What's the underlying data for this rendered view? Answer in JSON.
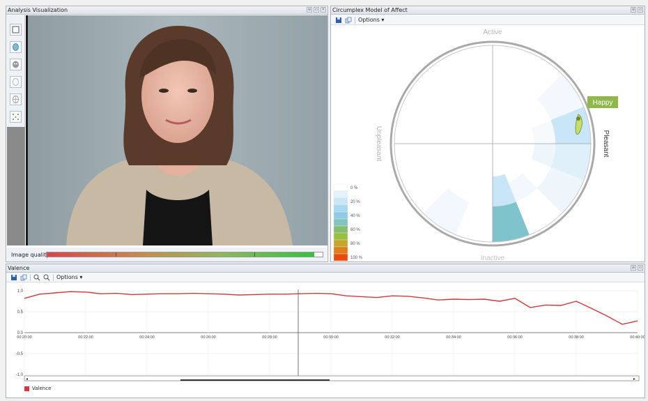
{
  "analysis": {
    "title": "Analysis Visualization",
    "image_quality_label": "Image quality",
    "image_quality_value": 0.97,
    "tools": [
      "select-tool-icon",
      "face-model-icon",
      "face-mask-icon",
      "face-outline-icon",
      "face-grid-icon",
      "points-icon"
    ]
  },
  "circumplex": {
    "title": "Circumplex Model of Affect",
    "options_label": "Options ▾",
    "axis_top": "Active",
    "axis_bottom": "Inactive",
    "axis_left": "Unpleasant",
    "axis_right": "Pleasant",
    "emotion_badge": "Happy",
    "badge_color": "#8fb84a",
    "legend": [
      {
        "label": "0 %",
        "color": "#ffffff"
      },
      {
        "label": "",
        "color": "#e3f2fb"
      },
      {
        "label": "20 %",
        "color": "#c8e6f7"
      },
      {
        "label": "",
        "color": "#a9d8f1"
      },
      {
        "label": "40 %",
        "color": "#8fcbe6"
      },
      {
        "label": "",
        "color": "#7fc4bf"
      },
      {
        "label": "60 %",
        "color": "#86be6c"
      },
      {
        "label": "",
        "color": "#9cbf3e"
      },
      {
        "label": "80 %",
        "color": "#c4a62a"
      },
      {
        "label": "",
        "color": "#e07d16"
      },
      {
        "label": "100 %",
        "color": "#e84b0c"
      }
    ]
  },
  "valence": {
    "title": "Valence",
    "options_label": "Options ▾",
    "legend_label": "Valence",
    "series_color": "#d7363a",
    "y_ticks": [
      "1.0",
      "0.5",
      "0.0",
      "-0.5",
      "-1.0"
    ],
    "x_ticks": [
      "00:20:00",
      "00:22:00",
      "00:24:00",
      "00:26:00",
      "00:28:00",
      "00:30:00",
      "00:32:00",
      "00:34:00",
      "00:36:00",
      "00:38:00",
      "00:40:00"
    ]
  },
  "chart_data": {
    "type": "line",
    "xlabel": "",
    "ylabel": "",
    "ylim": [
      -1,
      1
    ],
    "x": [
      "00:20:00",
      "00:20:30",
      "00:21:00",
      "00:21:30",
      "00:22:00",
      "00:22:30",
      "00:23:00",
      "00:23:30",
      "00:24:00",
      "00:24:30",
      "00:25:00",
      "00:25:30",
      "00:26:00",
      "00:26:30",
      "00:27:00",
      "00:27:30",
      "00:28:00",
      "00:28:30",
      "00:29:00",
      "00:29:30",
      "00:30:00",
      "00:30:30",
      "00:31:00",
      "00:31:30",
      "00:32:00",
      "00:32:30",
      "00:33:00",
      "00:33:30",
      "00:34:00",
      "00:34:30",
      "00:35:00",
      "00:35:30",
      "00:36:00",
      "00:36:30",
      "00:37:00",
      "00:37:30",
      "00:38:00",
      "00:38:30",
      "00:39:00",
      "00:39:30",
      "00:40:00"
    ],
    "series": [
      {
        "values": [
          0.82,
          0.92,
          0.95,
          0.98,
          0.97,
          0.93,
          0.94,
          0.91,
          0.92,
          0.93,
          0.93,
          0.94,
          0.93,
          0.92,
          0.9,
          0.91,
          0.92,
          0.92,
          0.93,
          0.94,
          0.93,
          0.88,
          0.86,
          0.84,
          0.88,
          0.87,
          0.83,
          0.78,
          0.8,
          0.79,
          0.8,
          0.75,
          0.82,
          0.6,
          0.66,
          0.65,
          0.75,
          0.58,
          0.4,
          0.2,
          0.28
        ]
      }
    ],
    "grid": true
  }
}
